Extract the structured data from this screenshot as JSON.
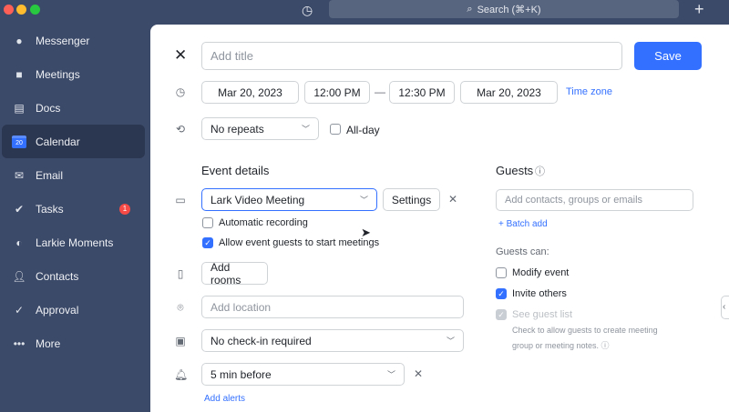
{
  "window": {
    "search_label": "Search (⌘+K)",
    "colors": {
      "close": "#fe5f57",
      "min": "#febc2e",
      "max": "#28c840",
      "accent": "#3370ff"
    }
  },
  "sidebar": {
    "items": [
      {
        "label": "Messenger",
        "icon": "chat-bubbles-icon"
      },
      {
        "label": "Meetings",
        "icon": "video-camera-icon"
      },
      {
        "label": "Docs",
        "icon": "docs-icon"
      },
      {
        "label": "Calendar",
        "icon": "calendar-icon",
        "calendar_day": "20",
        "active": true
      },
      {
        "label": "Email",
        "icon": "envelope-icon"
      },
      {
        "label": "Tasks",
        "icon": "checkmark-icon",
        "badge": "1"
      },
      {
        "label": "Larkie Moments",
        "icon": "planet-icon"
      },
      {
        "label": "Contacts",
        "icon": "person-icon"
      },
      {
        "label": "Approval",
        "icon": "approval-icon"
      },
      {
        "label": "More",
        "icon": "more-dots-icon"
      }
    ]
  },
  "event": {
    "title_placeholder": "Add title",
    "save_label": "Save",
    "start_date": "Mar 20, 2023",
    "start_time": "12:00 PM",
    "dash": "—",
    "end_time": "12:30 PM",
    "end_date": "Mar 20, 2023",
    "timezone_label": "Time zone",
    "repeat": "No repeats",
    "allday_label": "All-day",
    "details_heading": "Event details",
    "video_meeting": "Lark Video Meeting",
    "settings_label": "Settings",
    "auto_recording_label": "Automatic recording",
    "allow_guests_label": "Allow event guests to start meetings",
    "add_rooms_label": "Add rooms",
    "location_placeholder": "Add location",
    "checkin": "No check-in required",
    "alert": "5 min before",
    "add_alerts_label": "Add alerts"
  },
  "guests": {
    "heading": "Guests",
    "input_placeholder": "Add contacts, groups or emails",
    "batch_add_label": "+ Batch add",
    "can_label": "Guests can:",
    "modify_label": "Modify event",
    "invite_label": "Invite others",
    "see_list_label": "See guest list",
    "note_line1": "Check to allow guests to create meeting",
    "note_line2": "group or meeting notes. ⓘ"
  }
}
